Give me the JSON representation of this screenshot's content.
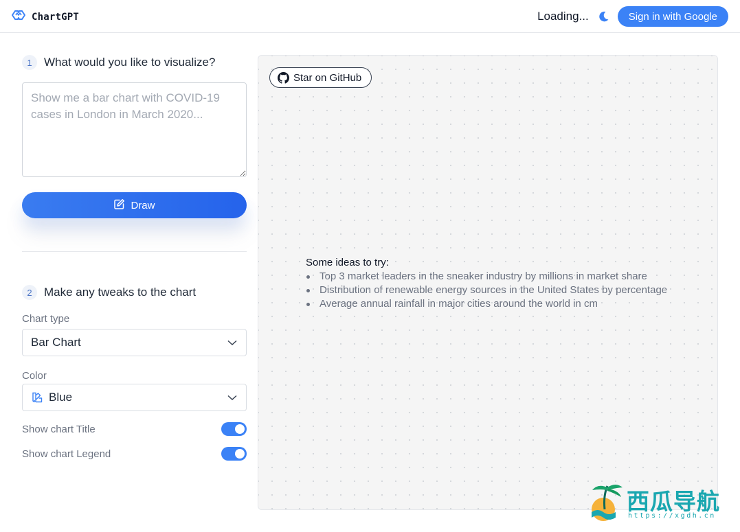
{
  "app": {
    "name": "ChartGPT"
  },
  "header": {
    "status": "Loading...",
    "sign_in_label": "Sign in with Google"
  },
  "step1": {
    "number": "1",
    "label": "What would you like to visualize?",
    "placeholder": "Show me a bar chart with COVID-19 cases in London in March 2020...",
    "value": ""
  },
  "draw_label": "Draw",
  "step2": {
    "number": "2",
    "label": "Make any tweaks to the chart",
    "chart_type_label": "Chart type",
    "chart_type_value": "Bar Chart",
    "color_label": "Color",
    "color_value": "Blue",
    "show_title_label": "Show chart Title",
    "show_title_on": true,
    "show_legend_label": "Show chart Legend",
    "show_legend_on": true
  },
  "canvas": {
    "github_label": "Star on GitHub",
    "ideas_title": "Some ideas to try:",
    "ideas": [
      "Top 3 market leaders in the sneaker industry by millions in market share",
      "Distribution of renewable energy sources in the United States by percentage",
      "Average annual rainfall in major cities around the world in cm"
    ]
  },
  "watermark": {
    "title": "西瓜导航",
    "url": "https://xgdh.cn"
  },
  "colors": {
    "accent": "#3b82f6",
    "primary_button": "#2563eb",
    "canvas_bg": "#f5f5f5"
  },
  "icons": {
    "logo": "chartgpt-logo-icon",
    "theme": "moon-icon",
    "draw": "edit-icon",
    "color": "palette-icon",
    "github": "github-icon"
  }
}
